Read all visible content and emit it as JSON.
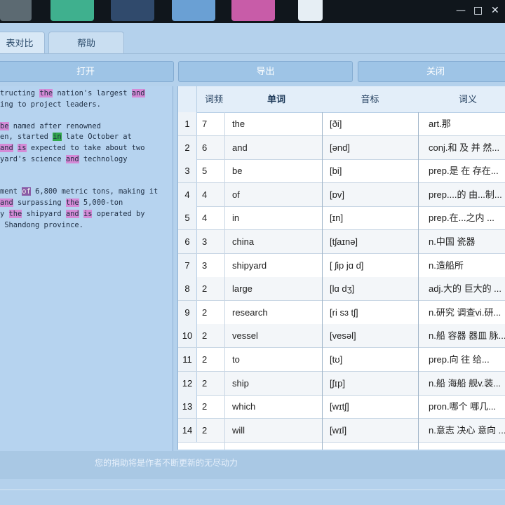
{
  "window": {
    "minimize_glyph": "—",
    "restore_glyph": "□",
    "close_glyph": "✕"
  },
  "tabs": [
    {
      "label": "表对比"
    },
    {
      "label": "帮助"
    }
  ],
  "toolbar": {
    "open_label": "打开",
    "export_label": "导出",
    "close_label": "关闭"
  },
  "text_panel": {
    "lines": [
      "tructing the nation's largest and",
      "ing to project leaders.",
      "",
      "be named after renowned",
      "en, started in late October at",
      "and is expected to take about two",
      "yard's science and technology",
      "",
      "",
      "ment of 6,800 metric tons, making it",
      "and surpassing the 5,000-ton",
      "y the shipyard and is operated by",
      " Shandong province."
    ]
  },
  "table": {
    "headers": {
      "freq": "词频",
      "word": "单词",
      "phonetic": "音标",
      "meaning": "词义"
    },
    "rows": [
      {
        "index": "1",
        "freq": "7",
        "word": "the",
        "phonetic": "[ði]",
        "meaning": "art.那"
      },
      {
        "index": "2",
        "freq": "6",
        "word": "and",
        "phonetic": "[ənd]",
        "meaning": "conj.和 及 并 然..."
      },
      {
        "index": "3",
        "freq": "5",
        "word": "be",
        "phonetic": "[bi]",
        "meaning": "prep.是 在 存在..."
      },
      {
        "index": "4",
        "freq": "4",
        "word": "of",
        "phonetic": "[ɒv]",
        "meaning": "prep....的 由...制..."
      },
      {
        "index": "5",
        "freq": "4",
        "word": "in",
        "phonetic": "[ɪn]",
        "meaning": "prep.在...之内 ..."
      },
      {
        "index": "6",
        "freq": "3",
        "word": "china",
        "phonetic": "[tʃaɪnə]",
        "meaning": "n.中国 瓷器"
      },
      {
        "index": "7",
        "freq": "3",
        "word": "shipyard",
        "phonetic": "[ ʃip jɑ d]",
        "meaning": "n.造船所"
      },
      {
        "index": "8",
        "freq": "2",
        "word": "large",
        "phonetic": "[lɑ dʒ]",
        "meaning": "adj.大的 巨大的 ..."
      },
      {
        "index": "9",
        "freq": "2",
        "word": "research",
        "phonetic": "[ri sɜ tʃ]",
        "meaning": "n.研究 调查vi.研..."
      },
      {
        "index": "10",
        "freq": "2",
        "word": "vessel",
        "phonetic": "[vesəl]",
        "meaning": "n.船 容器 器皿 脉..."
      },
      {
        "index": "11",
        "freq": "2",
        "word": "to",
        "phonetic": "[tʊ]",
        "meaning": "prep.向 往 给..."
      },
      {
        "index": "12",
        "freq": "2",
        "word": "ship",
        "phonetic": "[ʃɪp]",
        "meaning": "n.船 海船 舰v.装..."
      },
      {
        "index": "13",
        "freq": "2",
        "word": "which",
        "phonetic": "[wɪtʃ]",
        "meaning": "pron.哪个 哪几..."
      },
      {
        "index": "14",
        "freq": "2",
        "word": "will",
        "phonetic": "[wɪl]",
        "meaning": "n.意志 决心 意向 ..."
      }
    ]
  },
  "status": {
    "text": "您的捐助将是作者不断更新的无尽动力"
  },
  "colors": {
    "app_bg": "#b4d1ec",
    "button_bg": "#9ec4e6",
    "highlight_pink": "#d48ad6",
    "highlight_purple": "#8a5ca6",
    "highlight_green": "#30a84a"
  }
}
